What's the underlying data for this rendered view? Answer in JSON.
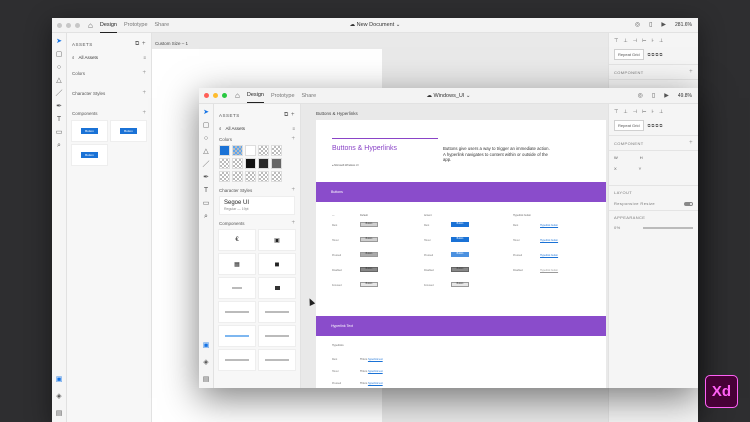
{
  "back_window": {
    "tabs": [
      "Design",
      "Prototype",
      "Share"
    ],
    "document_title": "New Document",
    "zoom": "281.6%",
    "assets_title": "ASSETS",
    "search_label": "All Assets",
    "sections": {
      "colors": "Colors",
      "character_styles": "Character Styles",
      "components": "Components"
    },
    "button_label": "Button",
    "artboard_label": "Custom Size – 1",
    "right_panel": {
      "repeat_grid": "Repeat Grid",
      "component": "COMPONENT"
    }
  },
  "front_window": {
    "tabs": [
      "Design",
      "Prototype",
      "Share"
    ],
    "document_title": "Windows_UI",
    "zoom": "49.8%",
    "assets_title": "ASSETS",
    "search_label": "All Assets",
    "sections": {
      "colors": "Colors",
      "character_styles": "Character Styles",
      "components": "Components"
    },
    "font": {
      "name": "Segoe UI",
      "sub": "Regular — 19pt"
    },
    "colors": [
      "#1a72d6",
      "#5ea6ef",
      "#ffffff",
      "#111111",
      "#2b2b2b",
      "#666666"
    ],
    "artboard_label": "Buttons & Hyperlinks",
    "hero": {
      "title": "Buttons & Hyperlinks",
      "description": "Buttons give users a way to trigger an immediate action. A hyperlink navigates to content within or outside of the app.",
      "meta": "Microsoft Windows UI"
    },
    "band_buttons": "Buttons",
    "table_headers": [
      "Default",
      "Accent",
      "Hyperlink button"
    ],
    "row_labels": [
      "Rest",
      "Hover",
      "Pressed",
      "Disabled",
      "Focused"
    ],
    "button_text": "Button",
    "hyperlink_text": "Hyperlink button",
    "band_hyperlink": "Hyperlink Text",
    "hyperlink_section": {
      "header": "Hyperlinks",
      "rows": [
        "Rest",
        "Hover",
        "Pressed",
        "Disabled"
      ],
      "prefix": "This is",
      "link": "hyperlink text"
    },
    "right_panel": {
      "repeat_grid": "Repeat Grid",
      "component": "COMPONENT",
      "layout": "LAYOUT",
      "responsive_resize": "Responsive Resize",
      "appearance": "APPEARANCE",
      "opacity": "0%",
      "fields": [
        "W",
        "H",
        "X",
        "Y"
      ]
    }
  },
  "xd_logo": "Xd",
  "icons": {
    "home": "home-icon",
    "cloud": "cloud-icon",
    "play": "play-icon",
    "mobile": "mobile-icon",
    "user": "user-icon"
  }
}
